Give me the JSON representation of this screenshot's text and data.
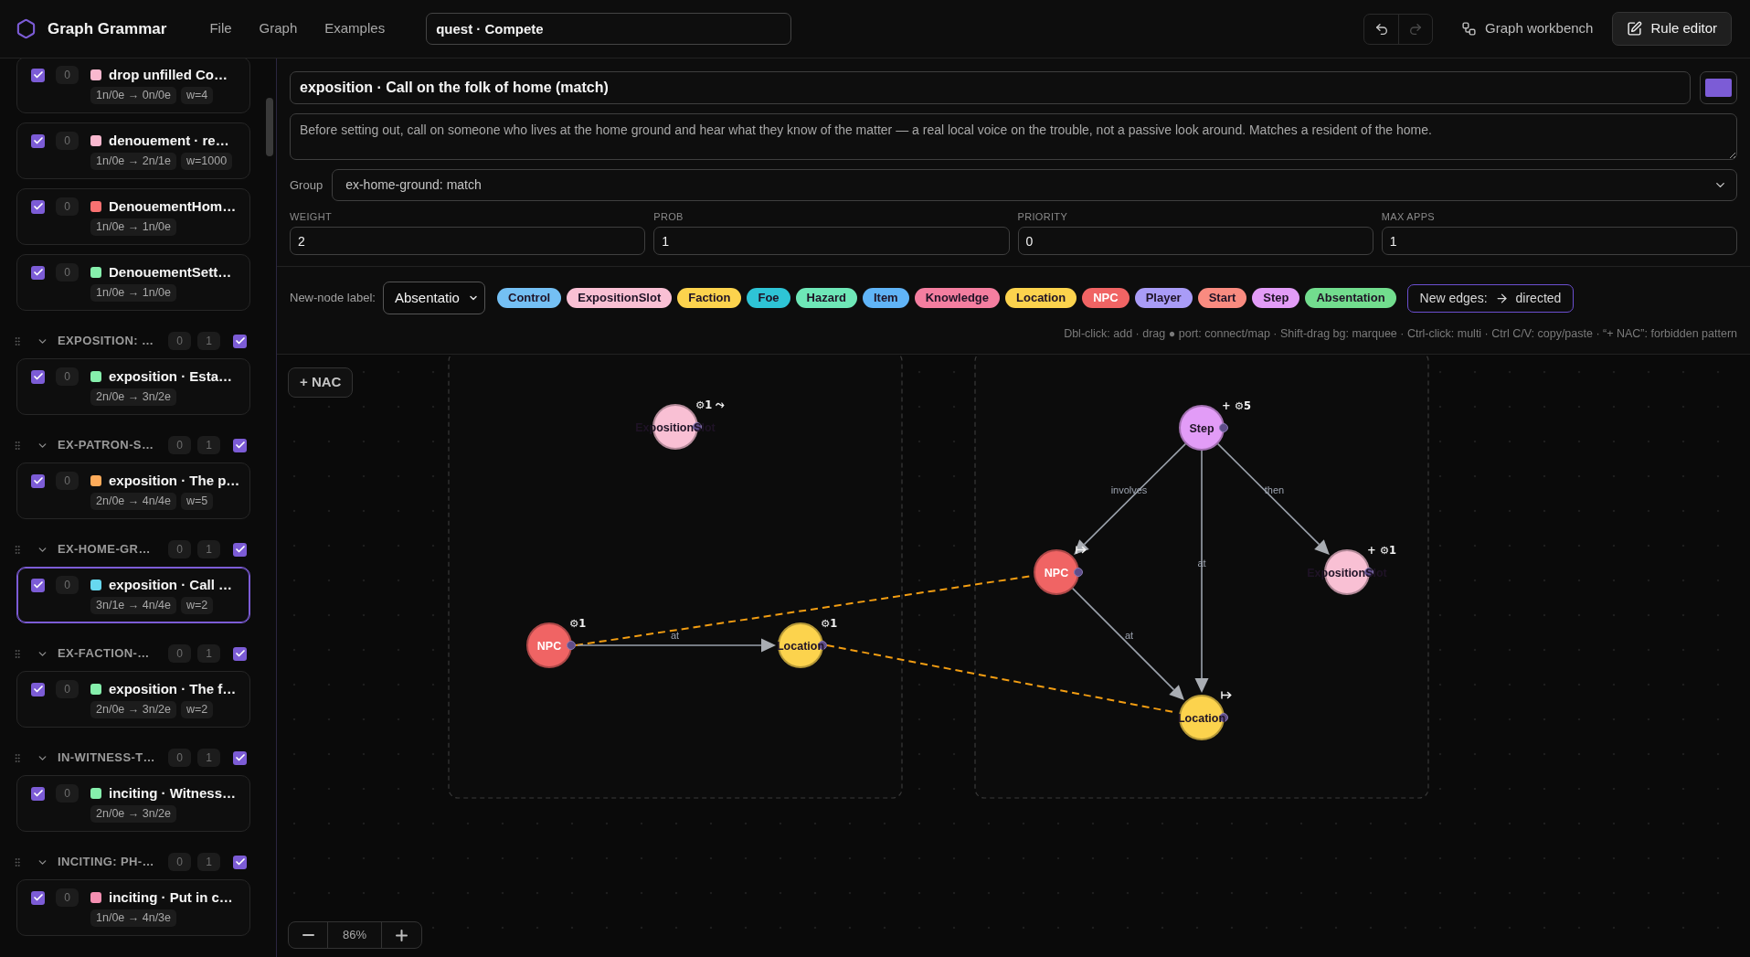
{
  "app_bar": {
    "title": "Graph Grammar",
    "menu": [
      "File",
      "Graph",
      "Examples"
    ],
    "document": {
      "value": "quest · Compete"
    },
    "history": [
      {
        "kind": "undo",
        "disabled": false
      },
      {
        "kind": "redo",
        "disabled": true
      }
    ],
    "views": [
      {
        "kind": "workbench",
        "label": "Graph workbench",
        "selected": false
      },
      {
        "kind": "editor",
        "label": "Rule editor",
        "selected": true
      }
    ]
  },
  "sidebar": {
    "items": [
      {
        "kind": "rule",
        "checked": true,
        "count": "0",
        "color": "#f9b8cf",
        "title": "drop unfilled Co…",
        "tags": [
          "1n/0e → 0n/0e",
          "w=4"
        ],
        "selected": false
      },
      {
        "kind": "rule",
        "checked": true,
        "count": "0",
        "color": "#f9b8cf",
        "title": "denouement · re…",
        "tags": [
          "1n/0e → 2n/1e",
          "w=1000"
        ],
        "selected": false
      },
      {
        "kind": "rule",
        "checked": true,
        "count": "0",
        "color": "#f87171",
        "title": "DenouementHom…",
        "tags": [
          "1n/0e → 1n/0e"
        ],
        "selected": false
      },
      {
        "kind": "rule",
        "checked": true,
        "count": "0",
        "color": "#86efac",
        "title": "DenouementSett…",
        "tags": [
          "1n/0e → 1n/0e"
        ],
        "selected": false
      },
      {
        "kind": "group",
        "label": "EXPOSITION: …",
        "counts": [
          "0",
          "1"
        ],
        "checked": true,
        "expanded": true,
        "children": [
          {
            "kind": "rule",
            "checked": true,
            "count": "0",
            "color": "#86efac",
            "title": "exposition · Esta…",
            "tags": [
              "2n/0e → 3n/2e"
            ],
            "selected": false
          }
        ]
      },
      {
        "kind": "group",
        "label": "EX-PATRON-S…",
        "counts": [
          "0",
          "1"
        ],
        "checked": true,
        "expanded": true,
        "children": [
          {
            "kind": "rule",
            "checked": true,
            "count": "0",
            "color": "#fdab5a",
            "title": "exposition · The p…",
            "tags": [
              "2n/0e → 4n/4e",
              "w=5"
            ],
            "selected": false
          }
        ]
      },
      {
        "kind": "group",
        "label": "EX-HOME-GR…",
        "counts": [
          "0",
          "1"
        ],
        "checked": true,
        "expanded": true,
        "children": [
          {
            "kind": "rule",
            "checked": true,
            "count": "0",
            "color": "#67d8ef",
            "title": "exposition · Call …",
            "tags": [
              "3n/1e → 4n/4e",
              "w=2"
            ],
            "selected": true
          }
        ]
      },
      {
        "kind": "group",
        "label": "EX-FACTION-…",
        "counts": [
          "0",
          "1"
        ],
        "checked": true,
        "expanded": true,
        "children": [
          {
            "kind": "rule",
            "checked": true,
            "count": "0",
            "color": "#86efac",
            "title": "exposition · The f…",
            "tags": [
              "2n/0e → 3n/2e",
              "w=2"
            ],
            "selected": false
          }
        ]
      },
      {
        "kind": "group",
        "label": "IN-WITNESS-T…",
        "counts": [
          "0",
          "1"
        ],
        "checked": true,
        "expanded": true,
        "children": [
          {
            "kind": "rule",
            "checked": true,
            "count": "0",
            "color": "#86efac",
            "title": "inciting · Witness…",
            "tags": [
              "2n/0e → 3n/2e"
            ],
            "selected": false
          }
        ]
      },
      {
        "kind": "group",
        "label": "INCITING: PH-…",
        "counts": [
          "0",
          "1"
        ],
        "checked": true,
        "expanded": true,
        "children": [
          {
            "kind": "rule",
            "checked": true,
            "count": "0",
            "color": "#f48fb1",
            "title": "inciting · Put in c…",
            "tags": [
              "1n/0e → 4n/3e"
            ],
            "selected": false
          }
        ]
      }
    ]
  },
  "rule": {
    "title": "exposition · Call on the folk of home (match)",
    "color": "#7c5cd6",
    "description": "Before setting out, call on someone who lives at the home ground and hear what they know of the matter — a real local voice on the trouble, not a passive look around. Matches a resident of the home.",
    "group": {
      "label": "Group",
      "value": "ex-home-ground: match"
    },
    "params": [
      {
        "label": "WEIGHT",
        "value": "2"
      },
      {
        "label": "PROB",
        "value": "1"
      },
      {
        "label": "PRIORITY",
        "value": "0"
      },
      {
        "label": "MAX APPS",
        "value": "1"
      }
    ]
  },
  "palette": {
    "label": "New-node label:",
    "value": "Absentatio",
    "labels": [
      {
        "text": "Control",
        "color": "#74c0f4"
      },
      {
        "text": "ExpositionSlot",
        "color": "#f9c0d4"
      },
      {
        "text": "Faction",
        "color": "#fcd34d"
      },
      {
        "text": "Foe",
        "color": "#2ec4d6"
      },
      {
        "text": "Hazard",
        "color": "#6ee7b7"
      },
      {
        "text": "Item",
        "color": "#60b4f7"
      },
      {
        "text": "Knowledge",
        "color": "#f47ea0"
      },
      {
        "text": "Location",
        "color": "#fcd34d"
      },
      {
        "text": "NPC",
        "color": "#f06464"
      },
      {
        "text": "Player",
        "color": "#a99cf7"
      },
      {
        "text": "Start",
        "color": "#f98b80"
      },
      {
        "text": "Step",
        "color": "#e29cf7"
      },
      {
        "text": "Absentation",
        "color": "#72dd8e"
      }
    ],
    "edge_mode": {
      "label": "New edges:",
      "value": "directed"
    },
    "hint": "Dbl-click: add · drag ● port: connect/map · Shift-drag bg: marquee · Ctrl-click: multi · Ctrl C/V: copy/paste · “+ NAC”: forbidden pattern"
  },
  "canvas": {
    "nac_button": "+ NAC",
    "zoom": "86%",
    "lhs": {
      "nodes": [
        {
          "label": "ExpositionSlot",
          "color": "#f9c0d4",
          "badge": "⚙1 ⤳"
        },
        {
          "label": "NPC",
          "color": "#f06464",
          "badge": "⚙1"
        },
        {
          "label": "Location",
          "color": "#fcd34d",
          "badge": "⚙1"
        }
      ],
      "edges": [
        {
          "label": "at"
        }
      ]
    },
    "rhs": {
      "nodes": [
        {
          "label": "Step",
          "color": "#e29cf7",
          "badge": "+ ⚙5",
          "mapped": false
        },
        {
          "label": "NPC",
          "color": "#f06464",
          "mapped": true
        },
        {
          "label": "ExpositionSlot",
          "color": "#f9c0d4",
          "badge": "+ ⚙1",
          "mapped": false
        },
        {
          "label": "Location",
          "color": "#fcd34d",
          "mapped": true
        }
      ],
      "edges": [
        {
          "label": "involves"
        },
        {
          "label": "then"
        },
        {
          "label": "at"
        },
        {
          "label": "at"
        }
      ]
    }
  }
}
